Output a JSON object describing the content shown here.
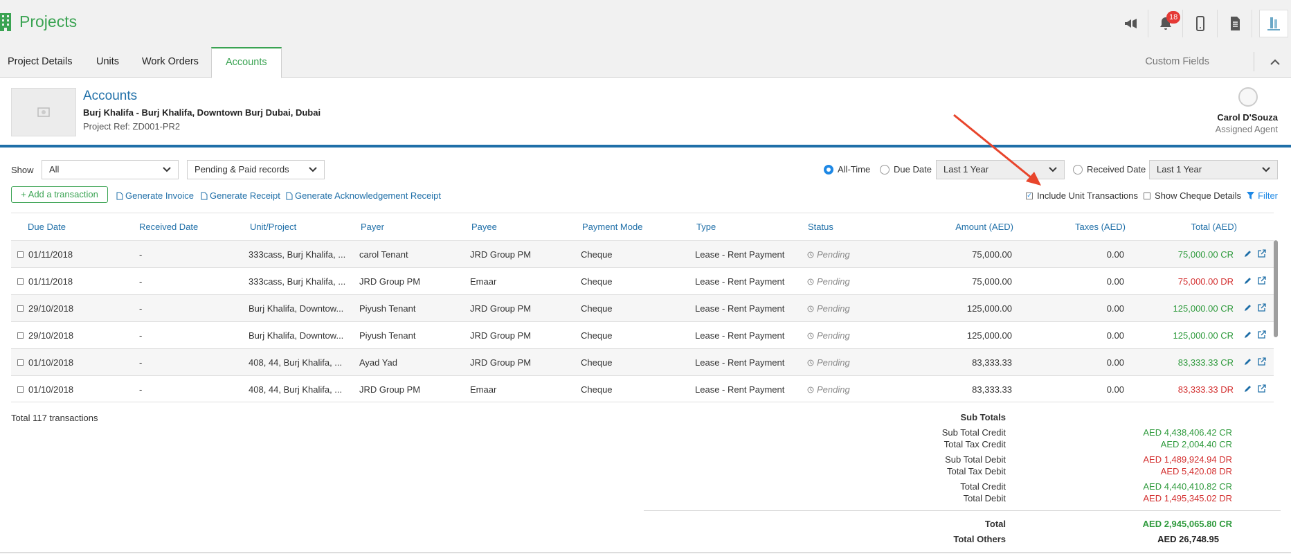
{
  "app": {
    "title": "Projects"
  },
  "topbar": {
    "notification_count": "18"
  },
  "tabs": [
    {
      "label": "Project Details"
    },
    {
      "label": "Units"
    },
    {
      "label": "Work Orders"
    },
    {
      "label": "Accounts"
    }
  ],
  "tabbar": {
    "custom_fields": "Custom Fields"
  },
  "header": {
    "title": "Accounts",
    "address": "Burj Khalifa - Burj Khalifa, Downtown Burj Dubai, Dubai",
    "project_ref": "Project Ref: ZD001-PR2",
    "agent_name": "Carol D'Souza",
    "agent_role": "Assigned Agent"
  },
  "filters": {
    "show_label": "Show",
    "show_value": "All",
    "records_value": "Pending & Paid records",
    "radio_all_time": "All-Time",
    "radio_due_date": "Due Date",
    "due_date_range": "Last 1 Year",
    "radio_received_date": "Received Date",
    "received_date_range": "Last 1 Year"
  },
  "actions": {
    "add_transaction": "+ Add a transaction",
    "generate_invoice": "Generate Invoice",
    "generate_receipt": "Generate Receipt",
    "generate_ack_receipt": "Generate Acknowledgement Receipt",
    "include_unit_transactions": "Include Unit Transactions",
    "show_cheque_details": "Show Cheque Details",
    "filter": "Filter"
  },
  "table": {
    "headers": {
      "due_date": "Due Date",
      "received_date": "Received Date",
      "unit_project": "Unit/Project",
      "payer": "Payer",
      "payee": "Payee",
      "payment_mode": "Payment Mode",
      "type": "Type",
      "status": "Status",
      "amount": "Amount (AED)",
      "taxes": "Taxes (AED)",
      "total": "Total (AED)"
    },
    "rows": [
      {
        "due": "01/11/2018",
        "received": "-",
        "unit": "333cass, Burj Khalifa, ...",
        "payer": "carol Tenant",
        "payee": "JRD Group PM",
        "mode": "Cheque",
        "type": "Lease - Rent Payment",
        "status": "Pending",
        "amount": "75,000.00",
        "taxes": "0.00",
        "total": "75,000.00 CR",
        "kind": "cr"
      },
      {
        "due": "01/11/2018",
        "received": "-",
        "unit": "333cass, Burj Khalifa, ...",
        "payer": "JRD Group PM",
        "payee": "Emaar",
        "mode": "Cheque",
        "type": "Lease - Rent Payment",
        "status": "Pending",
        "amount": "75,000.00",
        "taxes": "0.00",
        "total": "75,000.00 DR",
        "kind": "dr"
      },
      {
        "due": "29/10/2018",
        "received": "-",
        "unit": "Burj Khalifa, Downtow...",
        "payer": "Piyush Tenant",
        "payee": "JRD Group PM",
        "mode": "Cheque",
        "type": "Lease - Rent Payment",
        "status": "Pending",
        "amount": "125,000.00",
        "taxes": "0.00",
        "total": "125,000.00 CR",
        "kind": "cr"
      },
      {
        "due": "29/10/2018",
        "received": "-",
        "unit": "Burj Khalifa, Downtow...",
        "payer": "Piyush Tenant",
        "payee": "JRD Group PM",
        "mode": "Cheque",
        "type": "Lease - Rent Payment",
        "status": "Pending",
        "amount": "125,000.00",
        "taxes": "0.00",
        "total": "125,000.00 CR",
        "kind": "cr"
      },
      {
        "due": "01/10/2018",
        "received": "-",
        "unit": "408, 44, Burj Khalifa, ...",
        "payer": "Ayad Yad",
        "payee": "JRD Group PM",
        "mode": "Cheque",
        "type": "Lease - Rent Payment",
        "status": "Pending",
        "amount": "83,333.33",
        "taxes": "0.00",
        "total": "83,333.33 CR",
        "kind": "cr"
      },
      {
        "due": "01/10/2018",
        "received": "-",
        "unit": "408, 44, Burj Khalifa, ...",
        "payer": "JRD Group PM",
        "payee": "Emaar",
        "mode": "Cheque",
        "type": "Lease - Rent Payment",
        "status": "Pending",
        "amount": "83,333.33",
        "taxes": "0.00",
        "total": "83,333.33 DR",
        "kind": "dr"
      }
    ]
  },
  "totals": {
    "count_text": "Total 117 transactions",
    "sub_totals_heading": "Sub Totals",
    "sub_total_credit_label": "Sub Total Credit",
    "sub_total_credit": "AED 4,438,406.42 CR",
    "total_tax_credit_label": "Total Tax Credit",
    "total_tax_credit": "AED 2,004.40 CR",
    "sub_total_debit_label": "Sub Total Debit",
    "sub_total_debit": "AED 1,489,924.94 DR",
    "total_tax_debit_label": "Total Tax Debit",
    "total_tax_debit": "AED 5,420.08 DR",
    "total_credit_label": "Total Credit",
    "total_credit": "AED 4,440,410.82 CR",
    "total_debit_label": "Total Debit",
    "total_debit": "AED 1,495,345.02 DR",
    "total_label": "Total",
    "total": "AED 2,945,065.80 CR",
    "total_others_label": "Total Others",
    "total_others": "AED 26,748.95"
  },
  "colors": {
    "brand_green": "#3aa352",
    "link_blue": "#1f6fa8",
    "credit_green": "#2e9a3c",
    "debit_red": "#d32f2f",
    "annotation_arrow": "#e8452c"
  }
}
